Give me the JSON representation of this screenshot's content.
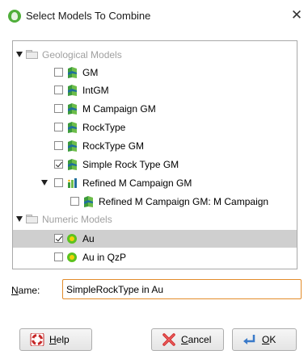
{
  "window": {
    "title": "Select Models To Combine",
    "close_glyph": "✕"
  },
  "tree": {
    "items": [
      {
        "label": "Geological Models",
        "kind": "group",
        "icon": "folder-icon"
      },
      {
        "label": "GM",
        "checked": false,
        "icon": "geological-model-icon"
      },
      {
        "label": "IntGM",
        "checked": false,
        "icon": "geological-model-icon"
      },
      {
        "label": "M Campaign GM",
        "checked": false,
        "icon": "geological-model-icon"
      },
      {
        "label": "RockType",
        "checked": false,
        "icon": "geological-model-icon"
      },
      {
        "label": "RockType GM",
        "checked": false,
        "icon": "geological-model-icon"
      },
      {
        "label": "Simple Rock Type GM",
        "checked": true,
        "icon": "geological-model-icon"
      },
      {
        "label": "Refined M Campaign GM",
        "checked": false,
        "icon": "refined-model-icon"
      },
      {
        "label": "Refined M Campaign GM: M Campaign",
        "checked": false,
        "icon": "geological-model-icon"
      },
      {
        "label": "Numeric Models",
        "kind": "group",
        "icon": "folder-icon"
      },
      {
        "label": "Au",
        "checked": true,
        "selected": true,
        "icon": "numeric-model-icon"
      },
      {
        "label": "Au in QzP",
        "checked": false,
        "icon": "numeric-model-icon"
      }
    ]
  },
  "name_field": {
    "label_u": "N",
    "label_rest": "ame:",
    "value": "SimpleRockType in Au"
  },
  "buttons": {
    "help": {
      "u": "H",
      "rest": "elp",
      "icon": "help-lifebuoy-icon"
    },
    "cancel": {
      "u": "C",
      "rest": "ancel",
      "icon": "cancel-x-icon"
    },
    "ok": {
      "u": "O",
      "rest": "K",
      "icon": "ok-return-arrow-icon"
    }
  },
  "colors": {
    "selection": "#cfcfcf",
    "input_focus_border": "#e38c2a",
    "group_text": "#a0a0a0"
  }
}
